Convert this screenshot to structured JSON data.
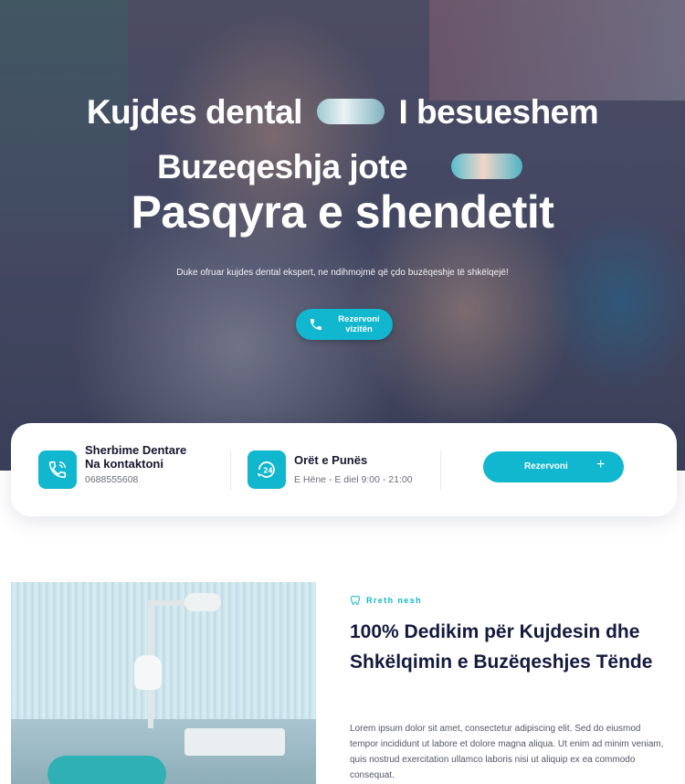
{
  "hero": {
    "line1_a": "Kujdes dental",
    "line1_b": "I besueshem",
    "line2": "Buzeqeshja jote",
    "line3": "Pasqyra e shendetit",
    "subtitle": "Duke ofruar kujdes dental ekspert, ne ndihmojmë që çdo buzëqeshje të shkëlqejë!",
    "button_label": "Rezervoni vizitën",
    "button_icon": "phone-icon"
  },
  "info_card": {
    "contact": {
      "icon": "phone-icon",
      "title": "Sherbime Dentare Na kontaktoni",
      "phone": "0688555608"
    },
    "hours": {
      "icon": "clock-24-icon",
      "title": "Orët e Punës",
      "value": "E Hëne - E diel 9:00 - 21:00"
    },
    "book_button": "Rezervoni",
    "book_icon": "plus-icon"
  },
  "about": {
    "tag": "Rreth nesh",
    "tag_icon": "tooth-icon",
    "title": "100%  Dedikim për Kujdesin dhe Shkëlqimin e Buzëqeshjes Tënde",
    "text": "Lorem ipsum dolor sit amet, consectetur adipiscing elit. Sed do eiusmod tempor incididunt ut labore et dolore magna aliqua. Ut enim ad minim veniam, quis nostrud exercitation ullamco laboris nisi ut aliquip ex ea commodo consequat."
  },
  "colors": {
    "accent": "#11b6cf",
    "heading": "#141a3d",
    "body_text": "#545767"
  }
}
